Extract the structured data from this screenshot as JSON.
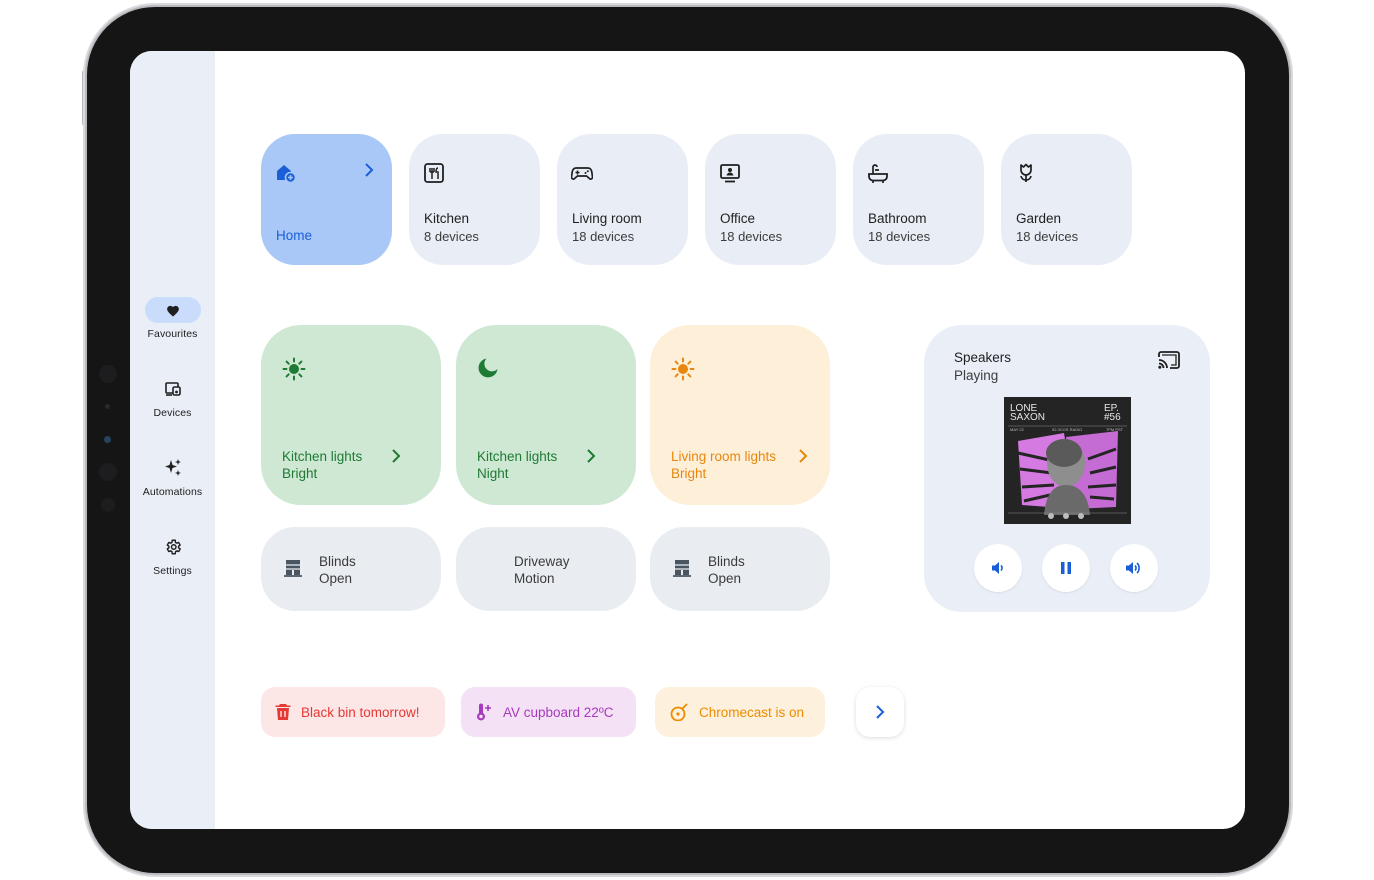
{
  "colors": {
    "accent_blue": "#1a5fd8",
    "home_tile": "#a9c8f8",
    "room_tile": "#e9eef6",
    "scene_green_bg": "#cfe8d4",
    "scene_green_text": "#1e7a34",
    "scene_orange_bg": "#feefd9",
    "scene_orange_text": "#e8870f",
    "chip_red_bg": "#fde6e6",
    "chip_red_text": "#e53935",
    "chip_purple_bg": "#f4e1f5",
    "chip_purple_text": "#a63bbd",
    "chip_orange_bg": "#fdf0dc",
    "chip_orange_text": "#ed8b00"
  },
  "nav": [
    {
      "label": "Favourites",
      "icon": "heart-icon",
      "active": true
    },
    {
      "label": "Devices",
      "icon": "devices-icon",
      "active": false
    },
    {
      "label": "Automations",
      "icon": "sparkle-icon",
      "active": false
    },
    {
      "label": "Settings",
      "icon": "gear-icon",
      "active": false
    }
  ],
  "rooms": [
    {
      "name": "Home",
      "icon": "home-icon"
    },
    {
      "name": "Kitchen",
      "devices": "8 devices",
      "icon": "kitchen-icon"
    },
    {
      "name": "Living room",
      "devices": "18 devices",
      "icon": "gamepad-icon"
    },
    {
      "name": "Office",
      "devices": "18 devices",
      "icon": "desk-icon"
    },
    {
      "name": "Bathroom",
      "devices": "18 devices",
      "icon": "bathtub-icon"
    },
    {
      "name": "Garden",
      "devices": "18 devices",
      "icon": "flower-icon"
    }
  ],
  "scenes": [
    {
      "line1": "Kitchen lights",
      "line2": "Bright",
      "icon": "sun-icon",
      "theme": "green"
    },
    {
      "line1": "Kitchen lights",
      "line2": "Night",
      "icon": "moon-icon",
      "theme": "green"
    },
    {
      "line1": "Living room lights",
      "line2": "Bright",
      "icon": "sun-icon",
      "theme": "orange"
    }
  ],
  "tiles": [
    {
      "line1": "Blinds",
      "line2": "Open",
      "icon": "blinds-icon"
    },
    {
      "line1": "Driveway",
      "line2": "Motion",
      "icon": ""
    },
    {
      "line1": "Blinds",
      "line2": "Open",
      "icon": "blinds-icon"
    }
  ],
  "speaker": {
    "title": "Speakers",
    "status": "Playing",
    "album": {
      "artist_line1": "LONE",
      "artist_line2": "SAXON",
      "episode_line1": "EP.",
      "episode_line2": "#56",
      "meta_date": "MAY 22",
      "meta_station": "92.3COS RADIO",
      "meta_time": "7PM PST"
    }
  },
  "alerts": [
    {
      "text": "Black bin tomorrow!",
      "icon": "trash-icon",
      "theme": "red"
    },
    {
      "text": "AV cupboard 22ºC",
      "icon": "thermometer-plus-icon",
      "theme": "purple"
    },
    {
      "text": "Chromecast is on",
      "icon": "cast-device-icon",
      "theme": "orange"
    }
  ]
}
